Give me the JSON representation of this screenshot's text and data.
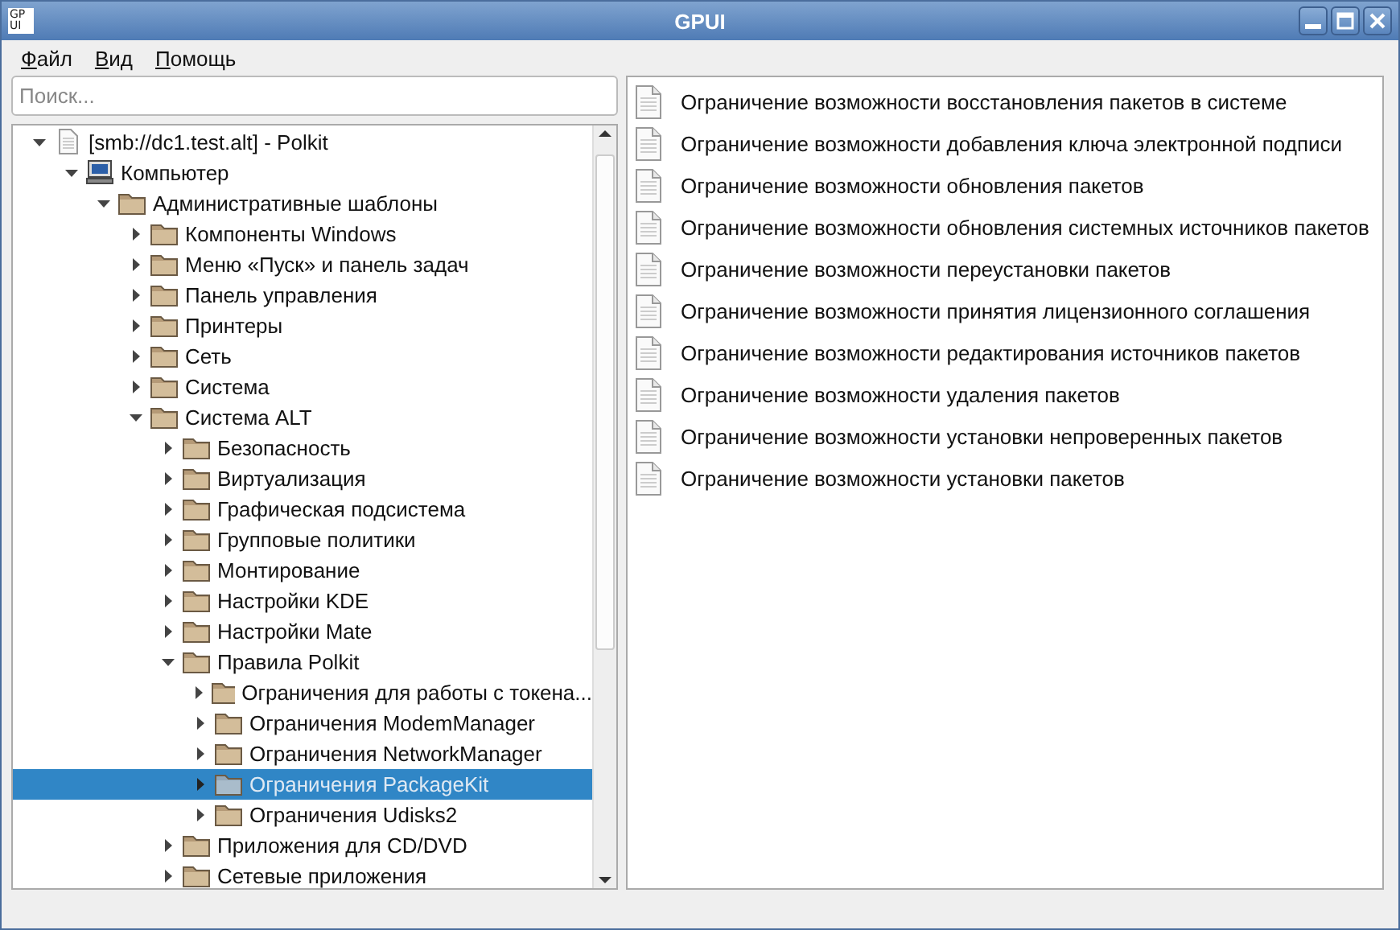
{
  "window": {
    "title": "GPUI",
    "app_icon": [
      "GP",
      "UI"
    ]
  },
  "menu": [
    "Файл",
    "Вид",
    "Помощь"
  ],
  "search": {
    "placeholder": "Поиск..."
  },
  "tree": [
    {
      "label": "[smb://dc1.test.alt] - Polkit",
      "kind": "document",
      "expanded": true,
      "selected": false,
      "children": [
        {
          "label": "Компьютер",
          "kind": "computer",
          "expanded": true,
          "selected": false,
          "children": [
            {
              "label": "Административные шаблоны",
              "kind": "folder",
              "expanded": true,
              "selected": false,
              "children": [
                {
                  "label": "Компоненты Windows",
                  "kind": "folder",
                  "expanded": false,
                  "selected": false
                },
                {
                  "label": "Меню «Пуск» и панель задач",
                  "kind": "folder",
                  "expanded": false,
                  "selected": false
                },
                {
                  "label": "Панель управления",
                  "kind": "folder",
                  "expanded": false,
                  "selected": false
                },
                {
                  "label": "Принтеры",
                  "kind": "folder",
                  "expanded": false,
                  "selected": false
                },
                {
                  "label": "Сеть",
                  "kind": "folder",
                  "expanded": false,
                  "selected": false
                },
                {
                  "label": "Система",
                  "kind": "folder",
                  "expanded": false,
                  "selected": false
                },
                {
                  "label": "Система ALT",
                  "kind": "folder",
                  "expanded": true,
                  "selected": false,
                  "children": [
                    {
                      "label": "Безопасность",
                      "kind": "folder",
                      "expanded": false,
                      "selected": false
                    },
                    {
                      "label": "Виртуализация",
                      "kind": "folder",
                      "expanded": false,
                      "selected": false
                    },
                    {
                      "label": "Графическая подсистема",
                      "kind": "folder",
                      "expanded": false,
                      "selected": false
                    },
                    {
                      "label": "Групповые политики",
                      "kind": "folder",
                      "expanded": false,
                      "selected": false
                    },
                    {
                      "label": "Монтирование",
                      "kind": "folder",
                      "expanded": false,
                      "selected": false
                    },
                    {
                      "label": "Настройки KDE",
                      "kind": "folder",
                      "expanded": false,
                      "selected": false
                    },
                    {
                      "label": "Настройки Mate",
                      "kind": "folder",
                      "expanded": false,
                      "selected": false
                    },
                    {
                      "label": "Правила Polkit",
                      "kind": "folder",
                      "expanded": true,
                      "selected": false,
                      "children": [
                        {
                          "label": "Ограничения для работы с токена...",
                          "kind": "folder",
                          "expanded": false,
                          "selected": false
                        },
                        {
                          "label": "Ограничения ModemManager",
                          "kind": "folder",
                          "expanded": false,
                          "selected": false
                        },
                        {
                          "label": "Ограничения NetworkManager",
                          "kind": "folder",
                          "expanded": false,
                          "selected": false
                        },
                        {
                          "label": "Ограничения PackageKit",
                          "kind": "folder",
                          "expanded": false,
                          "selected": true
                        },
                        {
                          "label": "Ограничения Udisks2",
                          "kind": "folder",
                          "expanded": false,
                          "selected": false
                        }
                      ]
                    },
                    {
                      "label": "Приложения для CD/DVD",
                      "kind": "folder",
                      "expanded": false,
                      "selected": false
                    },
                    {
                      "label": "Сетевые приложения",
                      "kind": "folder",
                      "expanded": false,
                      "selected": false
                    }
                  ]
                }
              ]
            }
          ]
        }
      ]
    }
  ],
  "policies": [
    "Ограничение возможности восстановления пакетов в системе",
    "Ограничение возможности добавления ключа электронной подписи",
    "Ограничение возможности обновления пакетов",
    "Ограничение возможности обновления системных источников пакетов",
    "Ограничение возможности переустановки пакетов",
    "Ограничение возможности принятия лицензионного соглашения",
    "Ограничение возможности редактирования источников пакетов",
    "Ограничение возможности удаления пакетов",
    "Ограничение возможности установки непроверенных пакетов",
    "Ограничение возможности установки пакетов"
  ]
}
